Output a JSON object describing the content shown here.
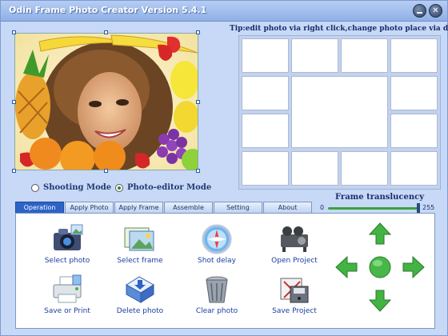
{
  "window": {
    "title": "Odin Frame Photo Creator Version 5.4.1"
  },
  "title_buttons": {
    "minimize": "minimize",
    "close": "close"
  },
  "modes": [
    {
      "label": "Shooting Mode",
      "selected": false
    },
    {
      "label": "Photo-editor Mode",
      "selected": true
    }
  ],
  "tip": "Tip:edit photo via right click,change photo place via drag it",
  "translucency": {
    "label": "Frame translucency",
    "min": "0",
    "max": "255",
    "value": 255
  },
  "tabs": [
    {
      "label": "Operation",
      "active": true
    },
    {
      "label": "Apply Photo",
      "active": false
    },
    {
      "label": "Apply Frame",
      "active": false
    },
    {
      "label": "Assemble photo",
      "active": false
    },
    {
      "label": "Setting",
      "active": false
    },
    {
      "label": "About",
      "active": false
    }
  ],
  "actions": {
    "select_photo": "Select photo",
    "select_frame": "Select frame",
    "shot_delay": "Shot delay",
    "open_project": "Open Project",
    "save_print": "Save or Print",
    "delete_photo": "Delete photo",
    "clear_photo": "Clear photo",
    "save_project": "Save Project"
  },
  "icons": {
    "title": "app-title",
    "navigation": [
      "up-arrow-icon",
      "left-arrow-icon",
      "center-button-icon",
      "right-arrow-icon",
      "down-arrow-icon"
    ]
  },
  "colors": {
    "accent": "#2d63c6",
    "window": "#c7d9f6",
    "nav_green": "#3fb23f"
  }
}
